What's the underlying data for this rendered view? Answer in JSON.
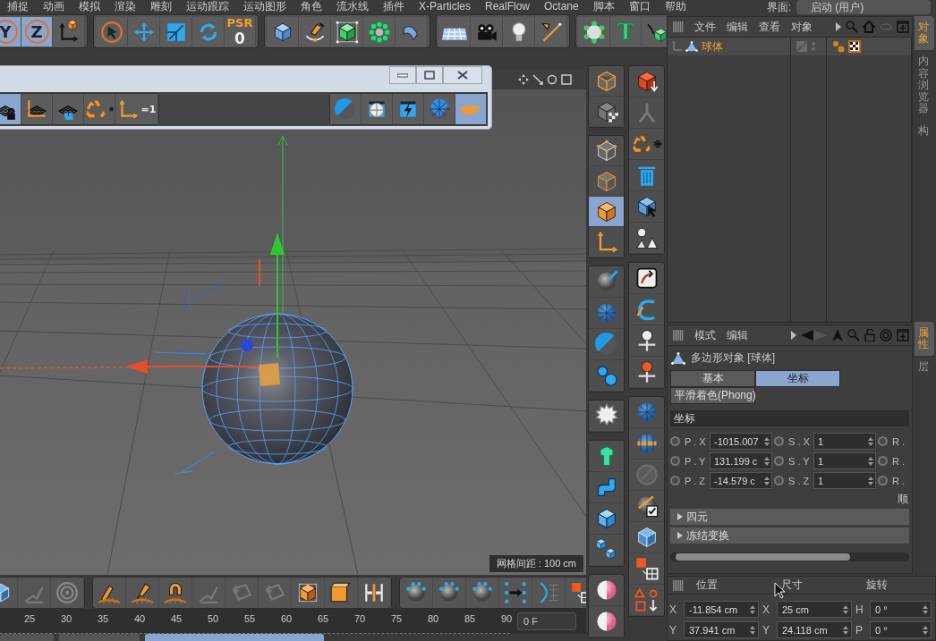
{
  "menu_bar": [
    "捕捉",
    "动画",
    "模拟",
    "渲染",
    "雕刻",
    "运动跟踪",
    "运动图形",
    "角色",
    "流水线",
    "插件",
    "X-Particles",
    "RealFlow",
    "Octane",
    "脚本",
    "窗口",
    "帮助"
  ],
  "layout_selector": {
    "label": "界面:",
    "value": "启动 (用户)"
  },
  "main_toolbar": {
    "axis_locks": [
      {
        "label": "Y",
        "selected": true
      },
      {
        "label": "Z",
        "selected": true
      }
    ],
    "psr": {
      "label": "PSR",
      "value": "0"
    },
    "text_tool": "T"
  },
  "palette": {
    "tools": [
      {
        "kind": "grid-lock",
        "selected": true
      },
      {
        "kind": "grid-axis",
        "selected": false
      },
      {
        "kind": "grid-camera",
        "selected": false
      },
      {
        "kind": "recycle",
        "selected": false
      },
      {
        "kind": "axis-one",
        "selected": false,
        "label": "=1"
      }
    ],
    "render_tools": [
      {
        "kind": "half-ball",
        "selected": false
      },
      {
        "kind": "ball-frame",
        "selected": false
      },
      {
        "kind": "bolt",
        "selected": false
      },
      {
        "kind": "mesh-ball",
        "selected": false
      },
      {
        "kind": "cup",
        "selected": true
      }
    ]
  },
  "viewport": {
    "grid_spacing": "网格间距 : 100 cm"
  },
  "mode_tools": [
    {
      "kind": "cube-outline",
      "selected": false
    },
    {
      "kind": "checker-cube",
      "selected": false
    },
    {
      "kind": "points",
      "selected": false
    },
    {
      "kind": "edges",
      "selected": false
    },
    {
      "kind": "polygons",
      "selected": true
    },
    {
      "kind": "axis",
      "selected": false
    }
  ],
  "object_manager": {
    "menu": [
      "文件",
      "编辑",
      "查看",
      "对象"
    ],
    "objects": [
      {
        "name": "球体",
        "selected": true
      }
    ]
  },
  "attributes": {
    "menu": [
      "模式",
      "编辑"
    ],
    "title": "多边形对象 [球体]",
    "tabs": [
      {
        "label": "基本",
        "selected": false
      },
      {
        "label": "坐标",
        "selected": true
      },
      {
        "label": "平滑着色(Phong)",
        "selected": false
      }
    ],
    "section": "坐标",
    "rows": [
      [
        {
          "label": "P . X",
          "value": "-1015.007",
          "keyed": false
        },
        {
          "label": "S . X",
          "value": "1",
          "keyed": false
        },
        {
          "label": "R .",
          "keyed": false
        }
      ],
      [
        {
          "label": "P . Y",
          "value": "131.199 c",
          "keyed": false
        },
        {
          "label": "S . Y",
          "value": "1",
          "keyed": false
        },
        {
          "label": "R .",
          "keyed": false
        }
      ],
      [
        {
          "label": "P . Z",
          "value": "-14.579 c",
          "keyed": false
        },
        {
          "label": "S . Z",
          "value": "1",
          "keyed": false
        },
        {
          "label": "R .",
          "keyed": false
        }
      ]
    ],
    "order_label": "顺",
    "groups": [
      {
        "label": "四元",
        "expanded": false
      },
      {
        "label": "冻结变换",
        "expanded": false
      }
    ]
  },
  "side_tabs": {
    "upper": [
      {
        "label": "对象",
        "selected": true
      },
      {
        "label": "内容浏览器",
        "selected": false
      },
      {
        "label": "构",
        "selected": false
      }
    ],
    "lower": [
      {
        "label": "属性",
        "selected": true
      },
      {
        "label": "层",
        "selected": false
      }
    ]
  },
  "coordinates": {
    "headers": [
      "位置",
      "尺寸",
      "旋转"
    ],
    "rows": [
      [
        {
          "axis": "X",
          "value": "-11.854 cm"
        },
        {
          "axis": "X",
          "value": "25 cm"
        },
        {
          "axis": "H",
          "value": "0 °"
        }
      ],
      [
        {
          "axis": "Y",
          "value": "37.941 cm"
        },
        {
          "axis": "Y",
          "value": "24.118 cm"
        },
        {
          "axis": "P",
          "value": "0 °"
        }
      ]
    ]
  },
  "timeline": {
    "ticks": [
      "25",
      "30",
      "35",
      "40",
      "45",
      "50",
      "55",
      "60",
      "65",
      "70",
      "75",
      "80",
      "85",
      "90"
    ],
    "frame_field": "0 F"
  }
}
